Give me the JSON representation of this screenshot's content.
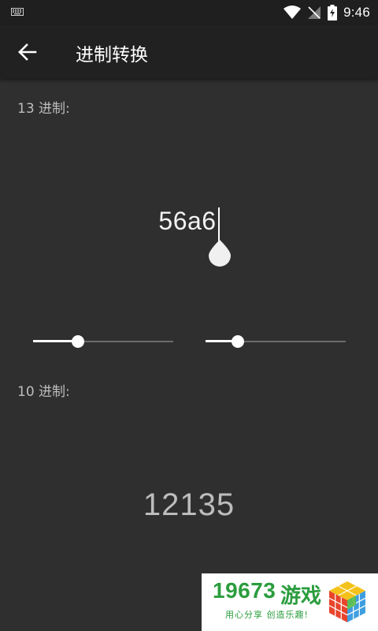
{
  "status_bar": {
    "time": "9:46",
    "icons": [
      "keyboard-icon",
      "wifi-icon",
      "no-signal-icon",
      "battery-charging-icon"
    ]
  },
  "app_bar": {
    "back_icon": "arrow-left-icon",
    "title": "进制转换"
  },
  "source": {
    "label": "13 进制:",
    "value": "56a6"
  },
  "sliders": [
    {
      "name": "source-base",
      "fraction": 0.32
    },
    {
      "name": "target-base",
      "fraction": 0.23
    }
  ],
  "target": {
    "label": "10 进制:",
    "value": "12135"
  },
  "watermark": {
    "number": "19673",
    "game": "游戏",
    "slogan": "用心分享 创造乐趣!"
  },
  "colors": {
    "background": "#2f2f2f",
    "app_bar": "#212121",
    "status_bar": "#1f1f1f",
    "watermark_green": "#2b9d3e"
  }
}
